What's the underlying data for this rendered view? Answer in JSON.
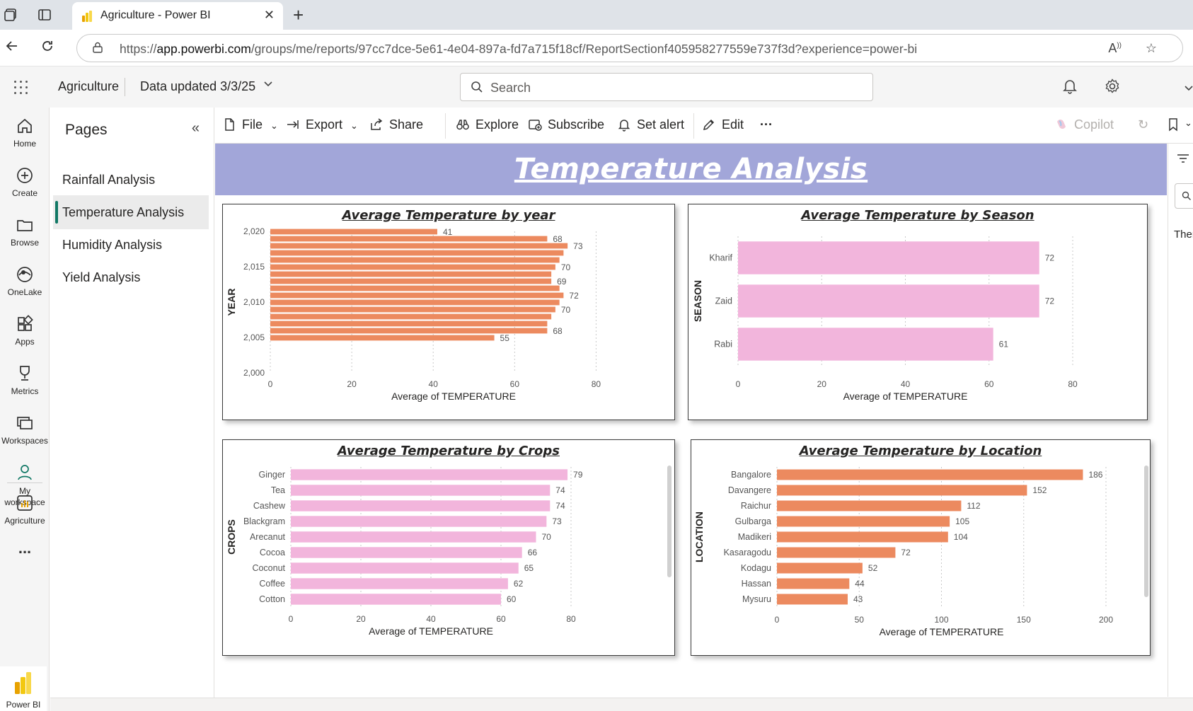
{
  "browser": {
    "tab_title": "Agriculture - Power BI",
    "url_prefix": "https://",
    "url_domain": "app.powerbi.com",
    "url_path": "/groups/me/reports/97cc7dce-5e61-4e04-897a-fd7a715f18cf/ReportSectionf405958277559e737f3d?experience=power-bi"
  },
  "header": {
    "workspace": "Agriculture",
    "data_updated": "Data updated 3/3/25",
    "search_placeholder": "Search"
  },
  "leftnav": {
    "items": [
      {
        "label": "Home",
        "icon": "home-icon"
      },
      {
        "label": "Create",
        "icon": "create-icon"
      },
      {
        "label": "Browse",
        "icon": "browse-icon"
      },
      {
        "label": "OneLake",
        "icon": "onelake-icon"
      },
      {
        "label": "Apps",
        "icon": "apps-icon"
      },
      {
        "label": "Metrics",
        "icon": "metrics-icon"
      },
      {
        "label": "Workspaces",
        "icon": "workspaces-icon"
      },
      {
        "label": "My workspace",
        "icon": "my-workspace-icon"
      },
      {
        "label": "Agriculture",
        "icon": "report-icon"
      }
    ],
    "more": "...",
    "brand": "Power BI"
  },
  "pages": {
    "title": "Pages",
    "items": [
      "Rainfall Analysis",
      "Temperature Analysis",
      "Humidity Analysis",
      "Yield Analysis"
    ],
    "active": "Temperature Analysis"
  },
  "toolbar": {
    "file": "File",
    "export": "Export",
    "share": "Share",
    "explore": "Explore",
    "subscribe": "Subscribe",
    "set_alert": "Set alert",
    "edit": "Edit",
    "more": "···",
    "copilot": "Copilot"
  },
  "report": {
    "banner_title": "Temperature Analysis"
  },
  "filters": {
    "truncated_text": "Ther"
  },
  "colors": {
    "orange_bar": "#ec8a5f",
    "pink_bar": "#f2b5dc",
    "banner": "#a2a6d9",
    "active_page_accent": "#117865"
  },
  "chart_data": [
    {
      "id": "year",
      "type": "bar",
      "orientation": "horizontal",
      "title": "Average Temperature by year",
      "xlabel": "Average of TEMPERATURE",
      "ylabel": "YEAR",
      "color": "#ec8a5f",
      "y_ticks": [
        "2,000",
        "2,005",
        "2,010",
        "2,015",
        "2,020"
      ],
      "ylim": [
        2000,
        2020
      ],
      "x_ticks": [
        "0",
        "20",
        "40",
        "60",
        "80"
      ],
      "xlim": [
        0,
        90
      ],
      "points": [
        {
          "year": 2020,
          "value": 41,
          "label": "41"
        },
        {
          "year": 2019,
          "value": 68,
          "label": "68"
        },
        {
          "year": 2018,
          "value": 73,
          "label": "73"
        },
        {
          "year": 2017,
          "value": 72,
          "label": ""
        },
        {
          "year": 2016,
          "value": 71,
          "label": ""
        },
        {
          "year": 2015,
          "value": 70,
          "label": "70"
        },
        {
          "year": 2014,
          "value": 69,
          "label": ""
        },
        {
          "year": 2013,
          "value": 69,
          "label": "69"
        },
        {
          "year": 2012,
          "value": 71,
          "label": ""
        },
        {
          "year": 2011,
          "value": 72,
          "label": "72"
        },
        {
          "year": 2010,
          "value": 71,
          "label": ""
        },
        {
          "year": 2009,
          "value": 70,
          "label": "70"
        },
        {
          "year": 2008,
          "value": 69,
          "label": ""
        },
        {
          "year": 2007,
          "value": 68,
          "label": ""
        },
        {
          "year": 2006,
          "value": 68,
          "label": "68"
        },
        {
          "year": 2005,
          "value": 55,
          "label": "55"
        }
      ]
    },
    {
      "id": "season",
      "type": "bar",
      "orientation": "horizontal",
      "title": "Average Temperature by Season",
      "xlabel": "Average of TEMPERATURE",
      "ylabel": "SEASON",
      "color": "#f2b5dc",
      "categories": [
        "Kharif",
        "Zaid",
        "Rabi"
      ],
      "values": [
        72,
        72,
        61
      ],
      "x_ticks": [
        "0",
        "20",
        "40",
        "60",
        "80"
      ],
      "xlim": [
        0,
        80
      ]
    },
    {
      "id": "crops",
      "type": "bar",
      "orientation": "horizontal",
      "title": "Average Temperature by Crops",
      "xlabel": "Average of TEMPERATURE",
      "ylabel": "CROPS",
      "color": "#f2b5dc",
      "categories": [
        "Ginger",
        "Tea",
        "Cashew",
        "Blackgram",
        "Arecanut",
        "Cocoa",
        "Coconut",
        "Coffee",
        "Cotton"
      ],
      "values": [
        79,
        74,
        74,
        73,
        70,
        66,
        65,
        62,
        60
      ],
      "x_ticks": [
        "0",
        "20",
        "40",
        "60",
        "80"
      ],
      "xlim": [
        0,
        80
      ]
    },
    {
      "id": "location",
      "type": "bar",
      "orientation": "horizontal",
      "title": "Average Temperature by Location",
      "xlabel": "Average of TEMPERATURE",
      "ylabel": "LOCATION",
      "color": "#ec8a5f",
      "categories": [
        "Bangalore",
        "Davangere",
        "Raichur",
        "Gulbarga",
        "Madikeri",
        "Kasaragodu",
        "Kodagu",
        "Hassan",
        "Mysuru"
      ],
      "values": [
        186,
        152,
        112,
        105,
        104,
        72,
        52,
        44,
        43
      ],
      "x_ticks": [
        "0",
        "50",
        "100",
        "150",
        "200"
      ],
      "xlim": [
        0,
        200
      ]
    }
  ]
}
